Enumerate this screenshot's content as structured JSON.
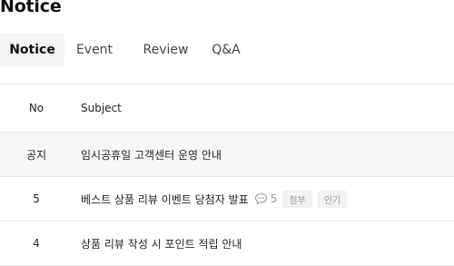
{
  "page": {
    "title": "Notice"
  },
  "tabs": [
    {
      "label": "Notice",
      "active": true
    },
    {
      "label": "Event",
      "active": false
    },
    {
      "label": "Review",
      "active": false
    },
    {
      "label": "Q&A",
      "active": false
    }
  ],
  "table": {
    "columns": {
      "no": "No",
      "subject": "Subject"
    },
    "rows": [
      {
        "no": "공지",
        "subject": "임시공휴일 고객센터 운영 안내"
      },
      {
        "no": "5",
        "subject": "베스트 상품 리뷰 이벤트 당첨자 발표",
        "comments": "5",
        "tags": [
          "첨부",
          "인기"
        ]
      },
      {
        "no": "4",
        "subject": "상품 리뷰 작성 시 포인트 적립 안내"
      }
    ]
  },
  "icons": {
    "comment": "speech-bubble-icon"
  }
}
